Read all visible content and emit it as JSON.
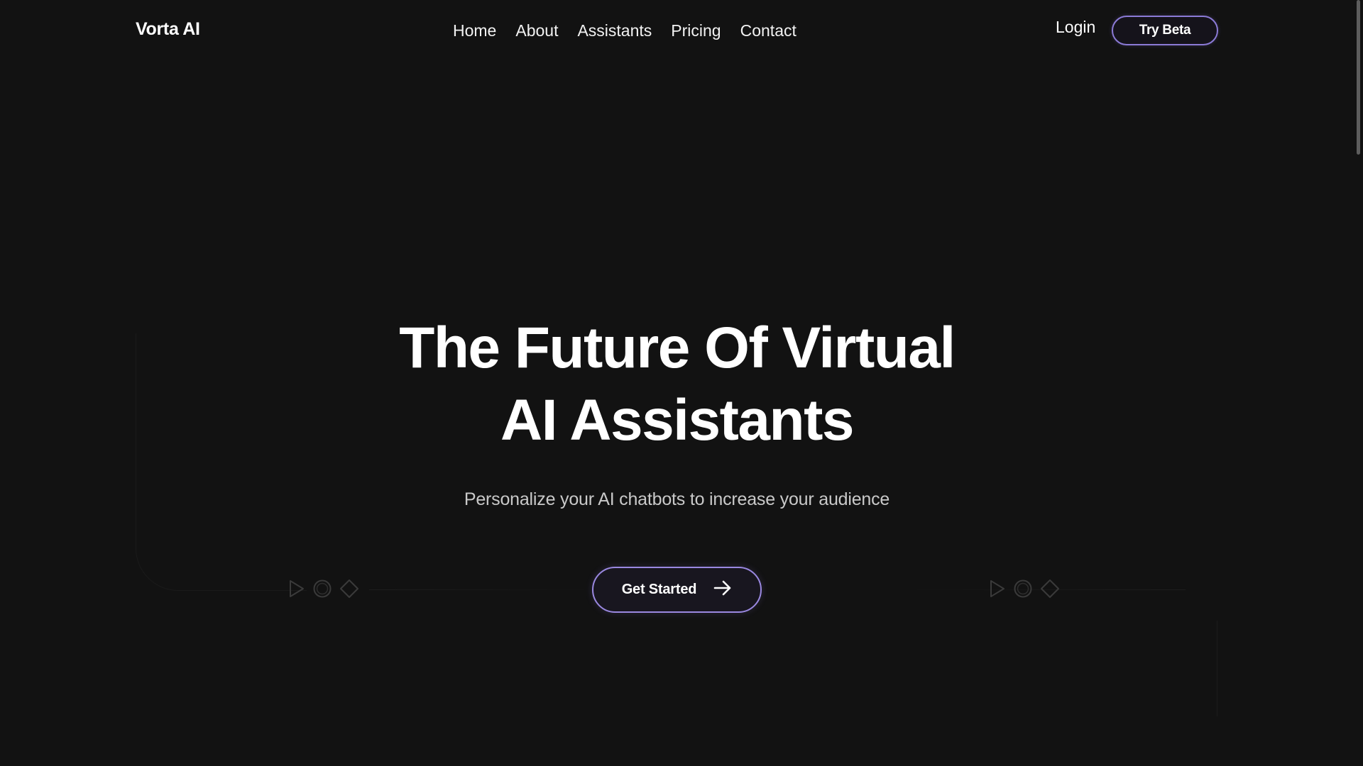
{
  "header": {
    "logo": "Vorta AI",
    "nav": [
      {
        "label": "Home"
      },
      {
        "label": "About"
      },
      {
        "label": "Assistants"
      },
      {
        "label": "Pricing"
      },
      {
        "label": "Contact"
      }
    ],
    "login_label": "Login",
    "try_beta_label": "Try Beta"
  },
  "hero": {
    "title_line1": "The Future Of Virtual",
    "title_line2": "AI Assistants",
    "subtitle": "Personalize your AI chatbots to increase your audience",
    "cta_label": "Get Started",
    "cta_icon": "arrow-right-icon"
  },
  "decorations": {
    "icons": [
      "play-icon",
      "circle-icon",
      "diamond-icon"
    ]
  },
  "colors": {
    "background": "#121212",
    "accent_border": "#9a88e0",
    "text_primary": "#ffffff",
    "text_secondary": "#c9c9c9"
  }
}
